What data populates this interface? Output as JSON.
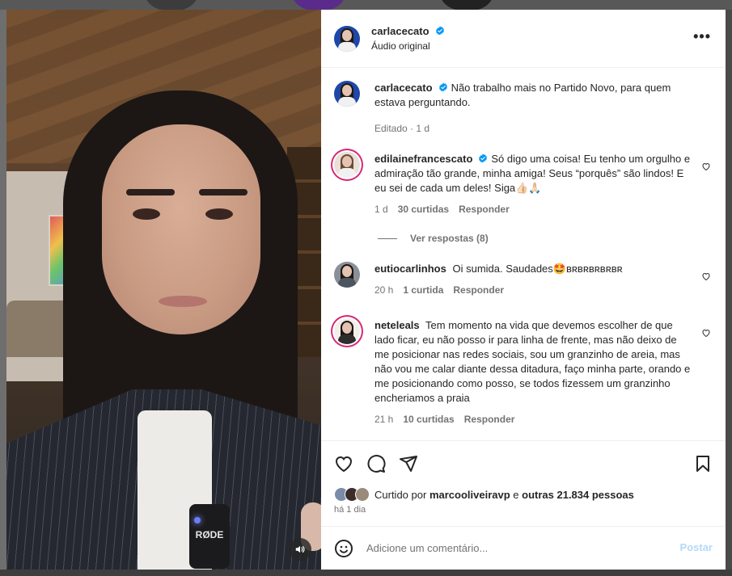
{
  "post": {
    "username": "carlacecato",
    "audio_label": "Áudio original",
    "more_label": "•••"
  },
  "caption": {
    "username": "carlacecato",
    "text": "Não trabalho mais no Partido Novo, para quem estava perguntando.",
    "meta": "Editado · 1 d"
  },
  "comments": [
    {
      "username": "edilainefrancescato",
      "verified": true,
      "text": "Só digo uma coisa! Eu tenho um orgulho e admiração tão grande, minha amiga! Seus “porquês” são lindos! E eu sei de cada um deles! Siga👍🏻🙏🏻",
      "time": "1 d",
      "likes": "30 curtidas",
      "reply": "Responder",
      "view_replies": "Ver respostas (8)"
    },
    {
      "username": "eutiocarlinhos",
      "verified": false,
      "text": "Oi sumida. Saudades🤩ʙʀʙʀʙʀʙʀʙʀ",
      "time": "20 h",
      "likes": "1 curtida",
      "reply": "Responder"
    },
    {
      "username": "neteleals",
      "verified": false,
      "text": "Tem momento na vida que devemos escolher de que lado ficar, eu não posso ir para linha de frente, mas não deixo de me posicionar nas redes sociais, sou um granzinho de areia, mas não vou me calar diante dessa ditadura, faço minha parte, orando e me posicionando como posso, se todos fizessem um granzinho encheriamos a praia",
      "time": "21 h",
      "likes": "10 curtidas",
      "reply": "Responder"
    }
  ],
  "likes_line": {
    "prefix": "Curtido por",
    "user": "marcooliveiravp",
    "joiner": "e",
    "others": "outras 21.834 pessoas"
  },
  "time_ago": "há 1 dia",
  "comment_box": {
    "placeholder": "Adicione um comentário...",
    "post_label": "Postar"
  },
  "media": {
    "mic_brand": "RØDE"
  },
  "colors": {
    "verified": "#0095f6",
    "post_disabled": "#b3d9fa"
  }
}
